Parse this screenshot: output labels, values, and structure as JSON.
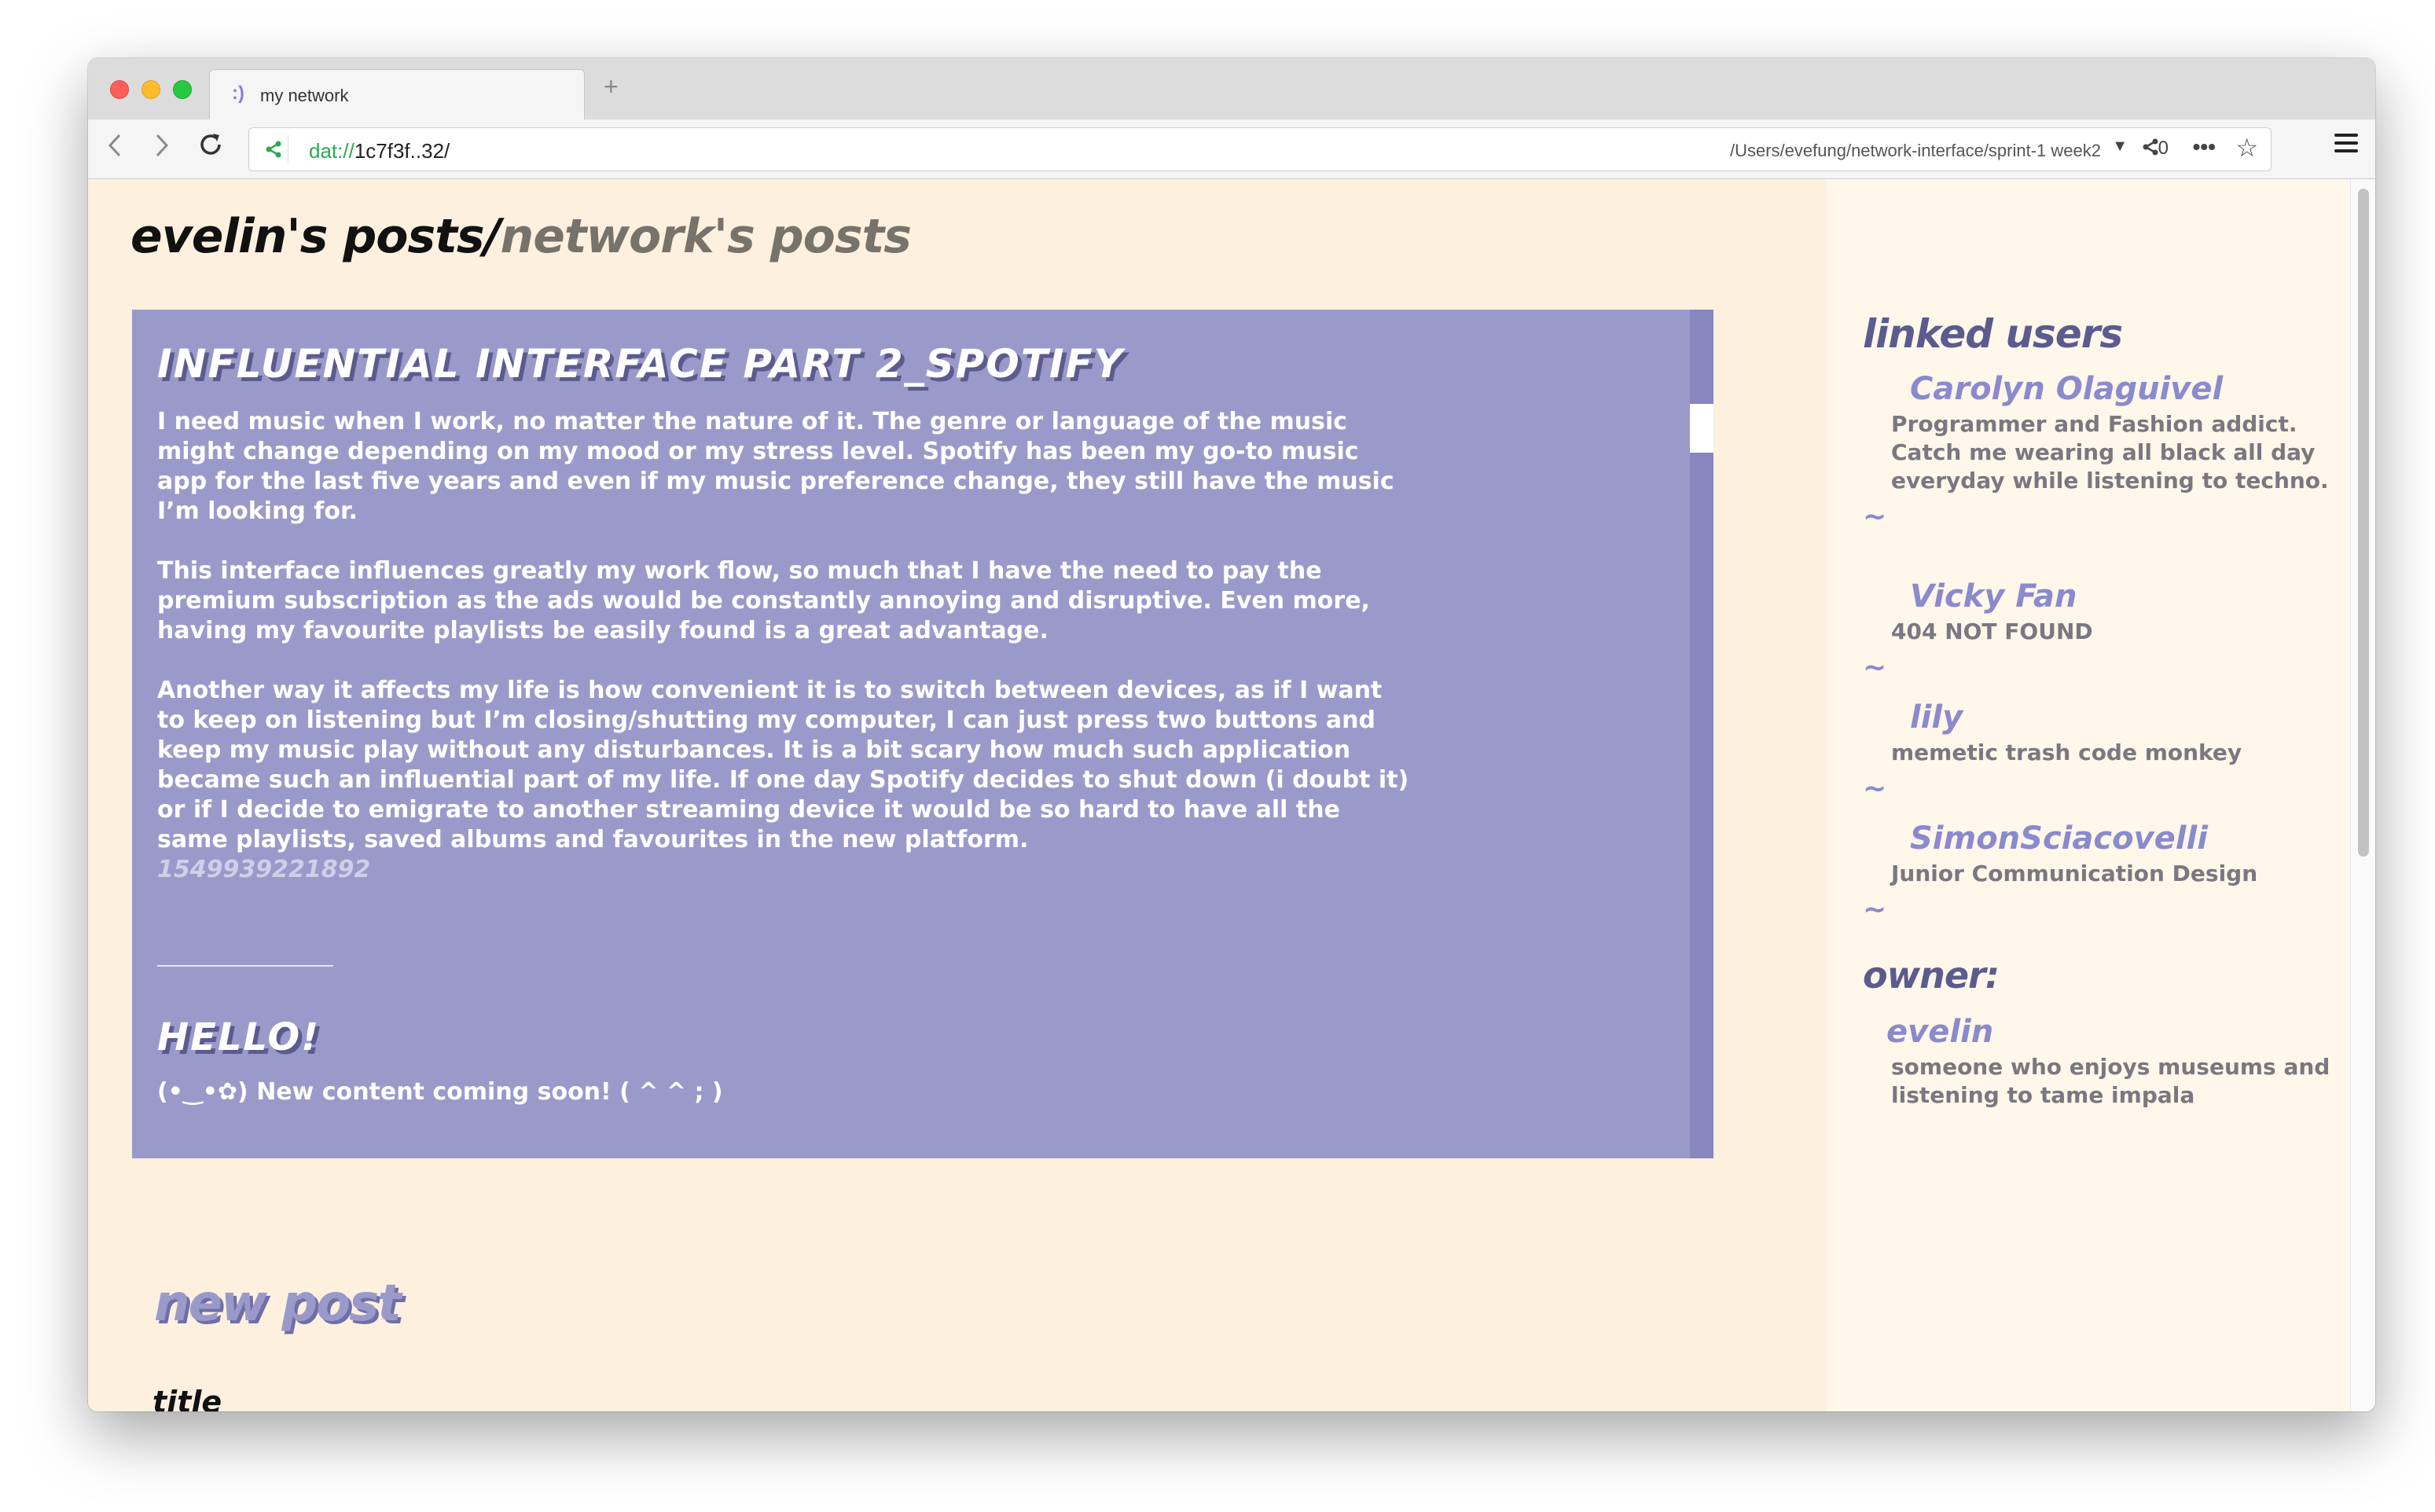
{
  "browser": {
    "tab": {
      "favicon": ":)",
      "title": "my network"
    },
    "new_tab_label": "+",
    "url": {
      "scheme": "dat://",
      "host": "1c7f3f..32/"
    },
    "local_path": "/Users/evefung/network-interface/sprint-1 week2",
    "peers_count": "0",
    "icons": {
      "back": "chevron-left-icon",
      "forward": "chevron-right-icon",
      "reload": "reload-icon",
      "share": "share-icon",
      "more": "more-icon",
      "bookmark": "star-icon",
      "menu": "hamburger-menu-icon"
    }
  },
  "page": {
    "title_mine": "evelin's posts",
    "title_sep": "/",
    "title_network": "network's posts",
    "posts": [
      {
        "title": "INFLUENTIAL INTERFACE PART 2_SPOTIFY",
        "paragraphs": [
          "I need music when I work, no matter the nature of it. The genre or language of the music might change depending on my mood or my stress level. Spotify has been my go-to music app for the last five years and even if my music preference change, they still have the music I’m looking for.",
          "This interface influences greatly my work flow, so much that I have the need to pay the premium subscription as the ads would be constantly annoying and disruptive. Even more, having my favourite playlists be easily found is a great advantage.",
          "Another way it affects my life is how convenient it is to switch between devices, as if I want to keep on listening but I’m closing/shutting my computer, I can just press two buttons and keep my music play without any disturbances. It is a bit scary how much such application became such an influential part of my life. If one day Spotify decides to shut down (i doubt it) or if I decide to emigrate to another streaming device it would be so hard to have all the same playlists, saved albums and favourites in the new platform."
        ],
        "timestamp": "1549939221892"
      },
      {
        "title": "HELLO!",
        "body": "(•‿•✿) New content coming soon! ( ^ ^ ; )"
      }
    ],
    "new_post": {
      "heading": "new post",
      "title_label": "title",
      "title_value": ""
    }
  },
  "sidebar": {
    "linked_heading": "linked users",
    "separator": "~",
    "users": [
      {
        "name": "Carolyn Olaguivel",
        "bio": "Programmer and Fashion addict. Catch me wearing all black all day everyday while listening to techno."
      },
      {
        "name": "Vicky Fan",
        "bio": "404 NOT FOUND"
      },
      {
        "name": "lily",
        "bio": "memetic trash code monkey"
      },
      {
        "name": "SimonSciacovelli",
        "bio": "Junior Communication Design"
      }
    ],
    "owner_heading": "owner:",
    "owner": {
      "name": "evelin",
      "bio": "someone who enjoys museums and listening to tame impala"
    }
  },
  "colors": {
    "page_bg": "#fdf0df",
    "sidebar_bg": "#fef7ea",
    "post_bg": "#9a9aca",
    "accent_purple": "#8a8acc",
    "heading_purple": "#5b5b8e",
    "muted_text": "#7a7780"
  }
}
